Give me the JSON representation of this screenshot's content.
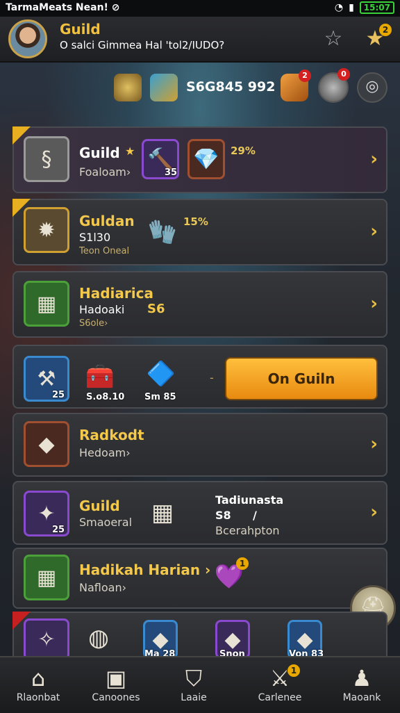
{
  "statusbar": {
    "app_name": "TarmaMeats Nean! ⊘",
    "time": "15:07"
  },
  "header": {
    "title": "Guild",
    "subtitle": "O salci Gimmea Hal 'tol2/IUDO?",
    "star_badge": "2"
  },
  "resources": {
    "value": "S6G845 992",
    "badge1": "2",
    "badge2": "0"
  },
  "rows": {
    "r1": {
      "title": "Guild",
      "star": "★",
      "sub": "Foaloam›",
      "pct": "29%",
      "item_label": "35"
    },
    "r2": {
      "title": "Guldan",
      "sub": "S1l30",
      "sub2": "Teon Oneal",
      "pct": "15%"
    },
    "r3": {
      "title": "Hadiarica",
      "sub": "Hadoaki",
      "val": "S6",
      "sub2": "S6ole›"
    },
    "r4": {
      "tile_label": "25",
      "item2_label": "S.o8.10",
      "item3_label": "Sm 85",
      "dash": "-",
      "button": "On Guiln"
    },
    "r5": {
      "title": "Radkodt",
      "sub": "Hedoam›"
    },
    "r6": {
      "title": "Guild",
      "sub": "Smaoeral",
      "tile_label": "25",
      "right_title": "Tadiunasta",
      "right_val1": "S8",
      "right_val2": "/",
      "right_sub": "Bcerahpton"
    },
    "r7": {
      "title": "Hadikah Harian ›",
      "sub": "Nafloan›",
      "badge": "1"
    },
    "r8": {
      "l1": "",
      "l2": "Ma 28",
      "l3": "Snon",
      "l4": "Von 83"
    }
  },
  "nav": [
    {
      "label": "Rlaonbat",
      "icon": "house-icon"
    },
    {
      "label": "Canoones",
      "icon": "box-icon"
    },
    {
      "label": "Laaie",
      "icon": "helmet-icon"
    },
    {
      "label": "Carlenee",
      "icon": "swords-icon",
      "badge": "1"
    },
    {
      "label": "Maoank",
      "icon": "user-icon"
    }
  ]
}
